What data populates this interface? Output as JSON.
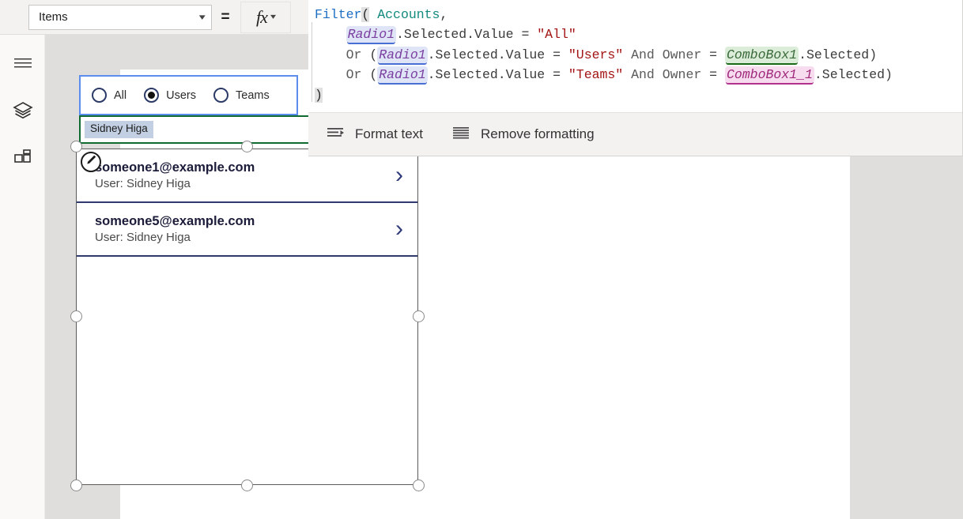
{
  "property_bar": {
    "selected_property": "Items",
    "dropdown_icon": "chevron-down-icon",
    "equals_sign": "=",
    "fx_glyph": "fx",
    "fx_chevron": "chevron-down-icon"
  },
  "left_rail": {
    "items": [
      {
        "name": "hamburger-menu",
        "icon": "hamburger-icon"
      },
      {
        "name": "tree-view",
        "icon": "layers-icon"
      },
      {
        "name": "insert",
        "icon": "grid-components-icon"
      }
    ]
  },
  "canvas": {
    "radio_control": {
      "control_name": "Radio1",
      "options": [
        {
          "label": "All",
          "selected": false
        },
        {
          "label": "Users",
          "selected": true
        },
        {
          "label": "Teams",
          "selected": false
        }
      ]
    },
    "combobox": {
      "control_name": "ComboBox1",
      "chip_value": "Sidney Higa"
    },
    "gallery": {
      "edit_badge_icon": "pencil-edit-icon",
      "items": [
        {
          "title": "someone1@example.com",
          "subtitle": "User: Sidney Higa",
          "chevron": "chevron-right-icon"
        },
        {
          "title": "someone5@example.com",
          "subtitle": "User: Sidney Higa",
          "chevron": "chevron-right-icon"
        }
      ]
    }
  },
  "formula_editor": {
    "lines": [
      [
        {
          "text": "Filter",
          "style": "fn"
        },
        {
          "text": "(",
          "style": "paren-hl"
        },
        {
          "text": " ",
          "style": "plain"
        },
        {
          "text": "Accounts",
          "style": "tbl"
        },
        {
          "text": ",",
          "style": "plain"
        }
      ],
      [
        {
          "text": "    ",
          "style": "plain"
        },
        {
          "text": "Radio1",
          "style": "ref-radio"
        },
        {
          "text": ".Selected.Value = ",
          "style": "plain"
        },
        {
          "text": "\"All\"",
          "style": "str"
        }
      ],
      [
        {
          "text": "    ",
          "style": "plain"
        },
        {
          "text": "Or",
          "style": "kw"
        },
        {
          "text": " (",
          "style": "plain"
        },
        {
          "text": "Radio1",
          "style": "ref-radio"
        },
        {
          "text": ".Selected.Value = ",
          "style": "plain"
        },
        {
          "text": "\"Users\"",
          "style": "str"
        },
        {
          "text": " ",
          "style": "plain"
        },
        {
          "text": "And",
          "style": "kw"
        },
        {
          "text": " ",
          "style": "plain"
        },
        {
          "text": "Owner",
          "style": "kw"
        },
        {
          "text": " = ",
          "style": "plain"
        },
        {
          "text": "ComboBox1",
          "style": "ref-cb1"
        },
        {
          "text": ".Selected)",
          "style": "plain"
        }
      ],
      [
        {
          "text": "    ",
          "style": "plain"
        },
        {
          "text": "Or",
          "style": "kw"
        },
        {
          "text": " (",
          "style": "plain"
        },
        {
          "text": "Radio1",
          "style": "ref-radio"
        },
        {
          "text": ".Selected.Value = ",
          "style": "plain"
        },
        {
          "text": "\"Teams\"",
          "style": "str"
        },
        {
          "text": " ",
          "style": "plain"
        },
        {
          "text": "And",
          "style": "kw"
        },
        {
          "text": " ",
          "style": "plain"
        },
        {
          "text": "Owner",
          "style": "kw"
        },
        {
          "text": " = ",
          "style": "plain"
        },
        {
          "text": "ComboBox1_1",
          "style": "ref-cb2"
        },
        {
          "text": ".Selected)",
          "style": "plain"
        }
      ],
      [
        {
          "text": ")",
          "style": "paren-hl"
        }
      ]
    ],
    "toolbar": {
      "format_text_label": "Format text",
      "format_text_icon": "format-text-icon",
      "remove_formatting_label": "Remove formatting",
      "remove_formatting_icon": "remove-formatting-icon"
    }
  },
  "colors": {
    "selection_blue": "#5b8def",
    "combobox_green": "#0f6b30",
    "gallery_separator": "#2f3a6e",
    "canvas_background": "#e0dedc",
    "rail_background": "#faf9f8"
  }
}
